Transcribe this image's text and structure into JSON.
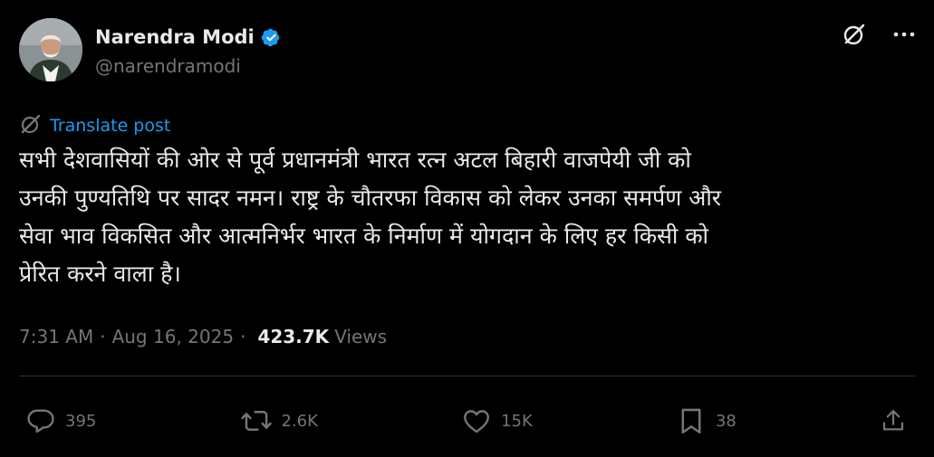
{
  "author": {
    "name": "Narendra Modi",
    "handle": "@narendramodi",
    "verified": true
  },
  "translate": {
    "label": "Translate post"
  },
  "post": {
    "lines": [
      "सभी देशवासियों की ओर से पूर्व प्रधानमंत्री भारत रत्न अटल बिहारी वाजपेयी जी को",
      "उनकी पुण्यतिथि पर सादर नमन। राष्ट्र के चौतरफा विकास को लेकर उनका समर्पण और",
      "सेवा भाव विकसित और आत्मनिर्भर भारत के निर्माण में योगदान के लिए हर किसी को",
      "प्रेरित करने वाला है।"
    ]
  },
  "meta": {
    "time": "7:31 AM",
    "date": "Aug 16, 2025",
    "separator": "·",
    "views_count": "423.7K",
    "views_label": "Views"
  },
  "actions": {
    "replies": "395",
    "reposts": "2.6K",
    "likes": "15K",
    "bookmarks": "38"
  },
  "colors": {
    "background": "#000000",
    "text": "#e7e9ea",
    "secondary": "#71767b",
    "link": "#1d9bf0",
    "verified": "#1d9bf0",
    "divider": "#2f3336"
  },
  "icons": {
    "top_right": [
      "grok-icon",
      "more-icon"
    ],
    "translate": "grok-icon",
    "actions": [
      "reply-icon",
      "repost-icon",
      "like-icon",
      "bookmark-icon",
      "share-icon"
    ]
  }
}
